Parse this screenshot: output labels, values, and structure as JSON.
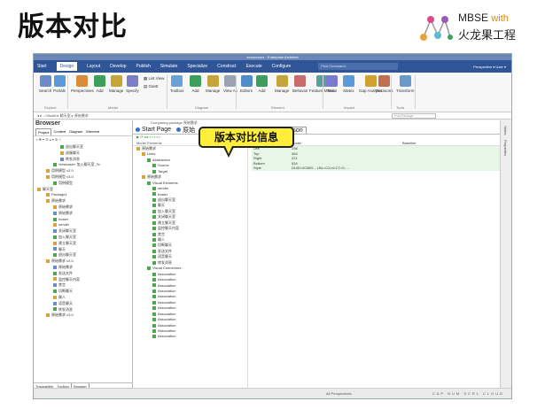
{
  "slide": {
    "title": "版本对比",
    "brand_line1": "MBSE",
    "brand_with": "with",
    "brand_line2": "火龙果工程"
  },
  "callout": {
    "text": "版本对比信息"
  },
  "window": {
    "title": "xxxxxxxxxx - Enterprise Architect",
    "menu": [
      "Start",
      "Design",
      "Layout",
      "Develop",
      "Publish",
      "Simulate",
      "Specialize",
      "Construct",
      "Execute",
      "Configure"
    ],
    "active_menu": "Design",
    "find_command": "Find Command...",
    "perspective": "Perspective ▾  User ▾"
  },
  "ribbon": {
    "buttons": [
      {
        "label": "Search",
        "color": "#6b8cc9"
      },
      {
        "label": "Portals",
        "color": "#5a9ad6"
      },
      {
        "label": "Perspectives",
        "color": "#d98c3a"
      },
      {
        "label": "Add",
        "color": "#3e9f5c"
      },
      {
        "label": "Manage",
        "color": "#c5a43a"
      },
      {
        "label": "Specify",
        "color": "#7e7ec6"
      },
      {
        "label": "Toolbox",
        "color": "#6aa2d8"
      },
      {
        "label": "Add",
        "color": "#3e9f5c"
      },
      {
        "label": "Manage",
        "color": "#c5a43a"
      },
      {
        "label": "View As",
        "color": "#9aa3b3"
      },
      {
        "label": "Editors",
        "color": "#4f8cc9"
      },
      {
        "label": "Add",
        "color": "#3e9f5c"
      },
      {
        "label": "Manage",
        "color": "#c5a43a"
      },
      {
        "label": "Behavior",
        "color": "#c96b6b"
      },
      {
        "label": "Feature Matrix",
        "color": "#5aa0a0"
      },
      {
        "label": "Trace",
        "color": "#7a7ad0"
      },
      {
        "label": "Matrix",
        "color": "#5a9ad6"
      },
      {
        "label": "Gap Analysis",
        "color": "#d0a030"
      },
      {
        "label": "Decisions",
        "color": "#c07050"
      },
      {
        "label": "Transform",
        "color": "#6a9acc"
      }
    ],
    "list_view": "List View",
    "gantt": "Gantt",
    "groups": [
      "Explore",
      "Model",
      "Diagram",
      "Element",
      "Impact",
      "Tools"
    ]
  },
  "pathbar": {
    "path": "◂ ▸ ◦  ⁄  Model ▸ 聊天室 ▸ 原始需求",
    "find": "Find Package"
  },
  "browser": {
    "title": "Browser",
    "tabs": [
      "Project",
      "Context",
      "Diagram",
      "Element"
    ],
    "tree": [
      {
        "indent": 30,
        "text": "退出聊天室"
      },
      {
        "indent": 30,
        "text": "退服聊天"
      },
      {
        "indent": 30,
        "text": "转发消息"
      },
      {
        "indent": 22,
        "text": "«testcase» 加入聊天室_Te"
      },
      {
        "indent": 14,
        "text": "用例模型 v2.0"
      },
      {
        "indent": 14,
        "text": "用例模型 v3.0"
      },
      {
        "indent": 22,
        "text": "用例模型"
      },
      {
        "indent": 4,
        "text": "聊天室"
      },
      {
        "indent": 14,
        "text": "Package1"
      },
      {
        "indent": 14,
        "text": "原始需求"
      },
      {
        "indent": 22,
        "text": "原始需求"
      },
      {
        "indent": 22,
        "text": "原始需求"
      },
      {
        "indent": 22,
        "text": "hoster"
      },
      {
        "indent": 22,
        "text": "sender"
      },
      {
        "indent": 22,
        "text": "关闭聊天室"
      },
      {
        "indent": 22,
        "text": "加入聊天室"
      },
      {
        "indent": 22,
        "text": "建立聊天室"
      },
      {
        "indent": 22,
        "text": "聊天"
      },
      {
        "indent": 22,
        "text": "退出聊天室"
      },
      {
        "indent": 14,
        "text": "原始需求 v2.0"
      },
      {
        "indent": 22,
        "text": "原始需求"
      },
      {
        "indent": 22,
        "text": "发送文件"
      },
      {
        "indent": 22,
        "text": "监控聊天内容"
      },
      {
        "indent": 22,
        "text": "禁言"
      },
      {
        "indent": 22,
        "text": "切断聊天"
      },
      {
        "indent": 22,
        "text": "踢人"
      },
      {
        "indent": 22,
        "text": "语音聊天"
      },
      {
        "indent": 22,
        "text": "转发消息"
      },
      {
        "indent": 14,
        "text": "原始需求 v3.0"
      }
    ],
    "footer_tabs": [
      "Traceability",
      "Toolbox",
      "Browser"
    ]
  },
  "compare": {
    "banner": "Comparing package 原始需求",
    "tabs": [
      {
        "label": "Start Page",
        "on": false
      },
      {
        "label": "原始",
        "on": false
      },
      {
        "label": "原始需求",
        "on": false
      },
      {
        "label": "Baseline Comparison",
        "on": true
      }
    ],
    "model_header": "Model Elements",
    "elements": [
      {
        "indent": 4,
        "text": "原始需求"
      },
      {
        "indent": 10,
        "text": "Links"
      },
      {
        "indent": 16,
        "text": "Abstraction"
      },
      {
        "indent": 22,
        "text": "Source"
      },
      {
        "indent": 22,
        "text": "Target"
      },
      {
        "indent": 10,
        "text": "原始需求"
      },
      {
        "indent": 16,
        "text": "Visual Elements"
      },
      {
        "indent": 22,
        "text": "sender"
      },
      {
        "indent": 22,
        "text": "hoster"
      },
      {
        "indent": 22,
        "text": "退出聊天室"
      },
      {
        "indent": 22,
        "text": "聊天"
      },
      {
        "indent": 22,
        "text": "加入聊天室"
      },
      {
        "indent": 22,
        "text": "关闭聊天室"
      },
      {
        "indent": 22,
        "text": "建立聊天室"
      },
      {
        "indent": 22,
        "text": "监控聊天内容"
      },
      {
        "indent": 22,
        "text": "禁言"
      },
      {
        "indent": 22,
        "text": "踢人"
      },
      {
        "indent": 22,
        "text": "切断聊天"
      },
      {
        "indent": 22,
        "text": "发送文件"
      },
      {
        "indent": 22,
        "text": "语音聊天"
      },
      {
        "indent": 22,
        "text": "转发消息"
      },
      {
        "indent": 16,
        "text": "Visual Connectors"
      },
      {
        "indent": 22,
        "text": "Association"
      },
      {
        "indent": 22,
        "text": "Association"
      },
      {
        "indent": 22,
        "text": "Association"
      },
      {
        "indent": 22,
        "text": "Association"
      },
      {
        "indent": 22,
        "text": "Association"
      },
      {
        "indent": 22,
        "text": "Association"
      },
      {
        "indent": 22,
        "text": "Association"
      },
      {
        "indent": 22,
        "text": "Association"
      },
      {
        "indent": 22,
        "text": "Association"
      },
      {
        "indent": 22,
        "text": "Association"
      },
      {
        "indent": 22,
        "text": "Association"
      },
      {
        "indent": 22,
        "text": "Association"
      }
    ],
    "table_header": [
      "",
      "Model",
      "Baseline"
    ],
    "properties": [
      [
        "Left",
        "236",
        ""
      ],
      [
        "Top",
        "464",
        ""
      ],
      [
        "Right",
        "221",
        ""
      ],
      [
        "Bottom",
        "534",
        ""
      ],
      [
        "Style",
        "DUID=0C8E0... LBL=CX=0:CY=0; ...",
        ""
      ]
    ]
  },
  "right_strip": [
    "Notes",
    "Properties"
  ],
  "status": {
    "perspectives": "All Perspectives",
    "caps": "CAP NUM SCRL CLOUD"
  }
}
